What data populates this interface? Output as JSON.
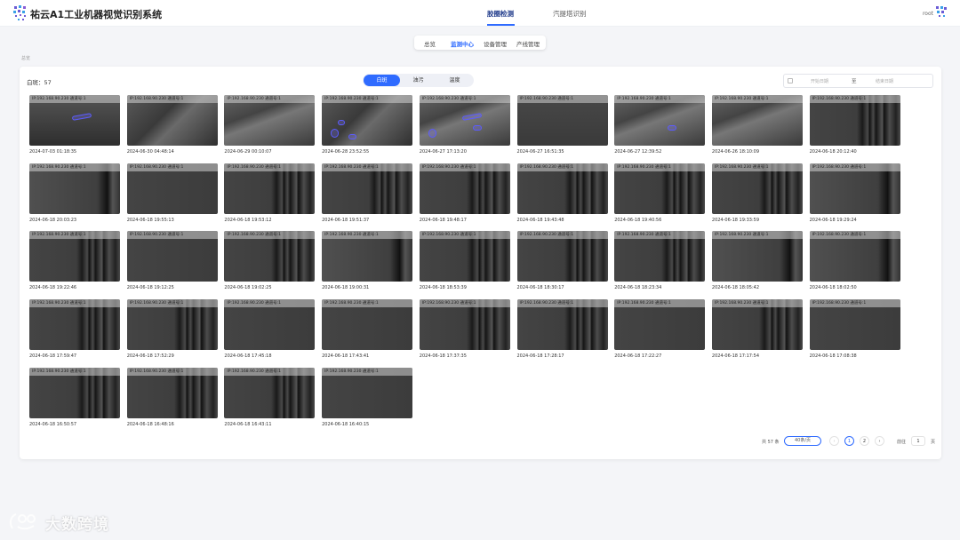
{
  "app": {
    "title": "祐云A1工业机器视觉识别系统"
  },
  "nav": {
    "items": [
      "胶圈检测",
      "汽提塔识别"
    ],
    "active": 0
  },
  "user": {
    "name": "root"
  },
  "subnav": {
    "items": [
      "总览",
      "监测中心",
      "设备管理",
      "产线管理"
    ],
    "active": 1
  },
  "breadcrumb": "总览",
  "panel": {
    "count_label": "白斑：57",
    "segments": {
      "items": [
        "白斑",
        "油污",
        "温度"
      ],
      "active": 0
    },
    "daterange": {
      "start_placeholder": "开始日期",
      "separator": "至",
      "end_placeholder": "结束日期"
    },
    "caption_prefix": "IP:192.168.90.230 通道号:1",
    "images": [
      {
        "time": "2024-07-03 01:18:35",
        "kind": 0,
        "blobs": [
          "b1"
        ]
      },
      {
        "time": "2024-06-30 04:48:14",
        "kind": 5,
        "blobs": []
      },
      {
        "time": "2024-06-29 00:10:07",
        "kind": 6,
        "blobs": []
      },
      {
        "time": "2024-06-28 23:52:55",
        "kind": 5,
        "blobs": [
          "b3",
          "b4",
          "b5"
        ]
      },
      {
        "time": "2024-06-27 17:13:20",
        "kind": 6,
        "blobs": [
          "b1",
          "b2",
          "b3"
        ]
      },
      {
        "time": "2024-06-27 16:51:35",
        "kind": 1,
        "blobs": []
      },
      {
        "time": "2024-06-27 12:39:52",
        "kind": 6,
        "blobs": [
          "b2"
        ]
      },
      {
        "time": "2024-06-26 18:10:09",
        "kind": 6,
        "blobs": []
      },
      {
        "time": "2024-06-18 20:12:40",
        "kind": 2,
        "blobs": []
      },
      {
        "time": "2024-06-18 20:03:23",
        "kind": 3,
        "blobs": []
      },
      {
        "time": "2024-06-18 19:55:13",
        "kind": 4,
        "blobs": []
      },
      {
        "time": "2024-06-18 19:53:12",
        "kind": 2,
        "blobs": []
      },
      {
        "time": "2024-06-18 19:51:37",
        "kind": 2,
        "blobs": []
      },
      {
        "time": "2024-06-18 19:48:17",
        "kind": 2,
        "blobs": []
      },
      {
        "time": "2024-06-18 19:43:48",
        "kind": 2,
        "blobs": []
      },
      {
        "time": "2024-06-18 19:40:56",
        "kind": 2,
        "blobs": []
      },
      {
        "time": "2024-06-18 19:33:59",
        "kind": 2,
        "blobs": []
      },
      {
        "time": "2024-06-18 19:29:24",
        "kind": 3,
        "blobs": []
      },
      {
        "time": "2024-06-18 19:22:46",
        "kind": 2,
        "blobs": []
      },
      {
        "time": "2024-06-18 19:12:25",
        "kind": 4,
        "blobs": []
      },
      {
        "time": "2024-06-18 19:02:25",
        "kind": 2,
        "blobs": []
      },
      {
        "time": "2024-06-18 19:00:31",
        "kind": 3,
        "blobs": []
      },
      {
        "time": "2024-06-18 18:53:39",
        "kind": 2,
        "blobs": []
      },
      {
        "time": "2024-06-18 18:30:17",
        "kind": 2,
        "blobs": []
      },
      {
        "time": "2024-06-18 18:23:34",
        "kind": 2,
        "blobs": []
      },
      {
        "time": "2024-06-18 18:05:42",
        "kind": 3,
        "blobs": []
      },
      {
        "time": "2024-06-18 18:02:50",
        "kind": 3,
        "blobs": []
      },
      {
        "time": "2024-06-18 17:59:47",
        "kind": 2,
        "blobs": []
      },
      {
        "time": "2024-06-18 17:52:29",
        "kind": 2,
        "blobs": []
      },
      {
        "time": "2024-06-18 17:45:18",
        "kind": 4,
        "blobs": []
      },
      {
        "time": "2024-06-18 17:43:41",
        "kind": 4,
        "blobs": []
      },
      {
        "time": "2024-06-18 17:37:35",
        "kind": 2,
        "blobs": []
      },
      {
        "time": "2024-06-18 17:28:17",
        "kind": 2,
        "blobs": []
      },
      {
        "time": "2024-06-18 17:22:27",
        "kind": 4,
        "blobs": []
      },
      {
        "time": "2024-06-18 17:17:54",
        "kind": 2,
        "blobs": []
      },
      {
        "time": "2024-06-18 17:08:38",
        "kind": 4,
        "blobs": []
      },
      {
        "time": "2024-06-18 16:50:57",
        "kind": 2,
        "blobs": []
      },
      {
        "time": "2024-06-18 16:48:16",
        "kind": 2,
        "blobs": []
      },
      {
        "time": "2024-06-18 16:43:11",
        "kind": 2,
        "blobs": []
      },
      {
        "time": "2024-06-18 16:40:15",
        "kind": 4,
        "blobs": []
      }
    ]
  },
  "pagination": {
    "total": "共 57 条",
    "page_size": "40条/页",
    "pages": [
      "1",
      "2"
    ],
    "current": "1",
    "goto_label": "前往",
    "goto_value": "1",
    "goto_suffix": "页",
    "prev": "‹",
    "next": "›"
  },
  "watermark": {
    "text": "大数跨境"
  },
  "colors": {
    "accent": "#2f6bff",
    "detection": "#5b5bff",
    "background": "#f4f5f8"
  }
}
